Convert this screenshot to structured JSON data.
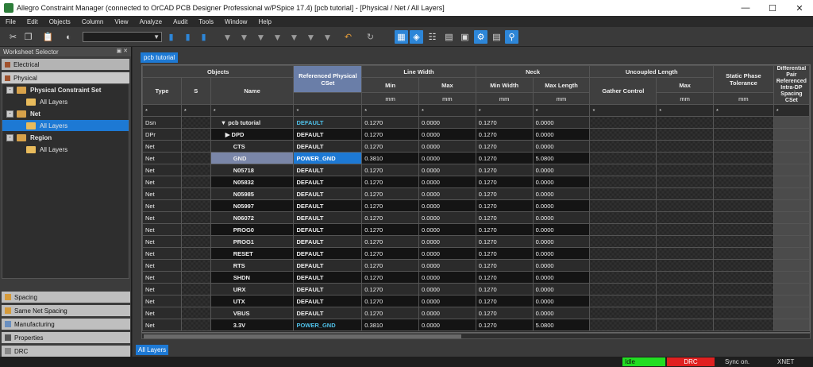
{
  "window": {
    "title": "Allegro Constraint Manager (connected to OrCAD PCB Designer Professional w/PSpice 17.4) [pcb tutorial] - [Physical / Net / All Layers]"
  },
  "menu": [
    "File",
    "Edit",
    "Objects",
    "Column",
    "View",
    "Analyze",
    "Audit",
    "Tools",
    "Window",
    "Help"
  ],
  "sidebar": {
    "title": "Worksheet Selector",
    "top_sets": [
      "Electrical",
      "Physical"
    ],
    "tree": [
      {
        "label": "Physical Constraint Set",
        "level": 0,
        "toggle": "-"
      },
      {
        "label": "All Layers",
        "level": 1
      },
      {
        "label": "Net",
        "level": 0,
        "toggle": "-"
      },
      {
        "label": "All Layers",
        "level": 1,
        "selected": true
      },
      {
        "label": "Region",
        "level": 0,
        "toggle": "-"
      },
      {
        "label": "All Layers",
        "level": 1
      }
    ],
    "bottom_sets": [
      "Spacing",
      "Same Net Spacing",
      "Manufacturing",
      "Properties",
      "DRC"
    ]
  },
  "tabs": {
    "top": "pcb tutorial",
    "bottom": "All Layers"
  },
  "grid": {
    "group_headers": {
      "objects": "Objects",
      "ref": "Referenced Physical CSet",
      "line_width": "Line Width",
      "neck": "Neck",
      "uncoupled": "Uncoupled Length",
      "phase": "Static Phase Tolerance",
      "diff": "Differential Pair Referenced Intra-DP Spacing CSet"
    },
    "sub_headers": {
      "type": "Type",
      "s": "S",
      "name": "Name",
      "min": "Min",
      "max": "Max",
      "min_width": "Min Width",
      "max_length": "Max Length",
      "gather": "Gather Control",
      "umax": "Max"
    },
    "unit": "mm",
    "filter": "*",
    "rows": [
      {
        "type": "Dsn",
        "name": "▼ pcb tutorial",
        "cset": "DEFAULT",
        "lmin": "0.1270",
        "lmax": "0.0000",
        "nmin": "0.1270",
        "nmax": "0.0000",
        "kind": "dsn"
      },
      {
        "type": "DPr",
        "name": "▶ DPD",
        "cset": "DEFAULT",
        "lmin": "0.1270",
        "lmax": "0.0000",
        "nmin": "0.1270",
        "nmax": "0.0000",
        "kind": "dpr"
      },
      {
        "type": "Net",
        "name": "CTS",
        "cset": "DEFAULT",
        "lmin": "0.1270",
        "lmax": "0.0000",
        "nmin": "0.1270",
        "nmax": "0.0000"
      },
      {
        "type": "Net",
        "name": "GND",
        "cset": "POWER_GND",
        "lmin": "0.3810",
        "lmax": "0.0000",
        "nmin": "0.1270",
        "nmax": "5.0800",
        "kind": "sel"
      },
      {
        "type": "Net",
        "name": "N05718",
        "cset": "DEFAULT",
        "lmin": "0.1270",
        "lmax": "0.0000",
        "nmin": "0.1270",
        "nmax": "0.0000"
      },
      {
        "type": "Net",
        "name": "N05832",
        "cset": "DEFAULT",
        "lmin": "0.1270",
        "lmax": "0.0000",
        "nmin": "0.1270",
        "nmax": "0.0000"
      },
      {
        "type": "Net",
        "name": "N05985",
        "cset": "DEFAULT",
        "lmin": "0.1270",
        "lmax": "0.0000",
        "nmin": "0.1270",
        "nmax": "0.0000"
      },
      {
        "type": "Net",
        "name": "N05997",
        "cset": "DEFAULT",
        "lmin": "0.1270",
        "lmax": "0.0000",
        "nmin": "0.1270",
        "nmax": "0.0000"
      },
      {
        "type": "Net",
        "name": "N06072",
        "cset": "DEFAULT",
        "lmin": "0.1270",
        "lmax": "0.0000",
        "nmin": "0.1270",
        "nmax": "0.0000"
      },
      {
        "type": "Net",
        "name": "PROG0",
        "cset": "DEFAULT",
        "lmin": "0.1270",
        "lmax": "0.0000",
        "nmin": "0.1270",
        "nmax": "0.0000"
      },
      {
        "type": "Net",
        "name": "PROG1",
        "cset": "DEFAULT",
        "lmin": "0.1270",
        "lmax": "0.0000",
        "nmin": "0.1270",
        "nmax": "0.0000"
      },
      {
        "type": "Net",
        "name": "RESET",
        "cset": "DEFAULT",
        "lmin": "0.1270",
        "lmax": "0.0000",
        "nmin": "0.1270",
        "nmax": "0.0000"
      },
      {
        "type": "Net",
        "name": "RTS",
        "cset": "DEFAULT",
        "lmin": "0.1270",
        "lmax": "0.0000",
        "nmin": "0.1270",
        "nmax": "0.0000"
      },
      {
        "type": "Net",
        "name": "SHDN",
        "cset": "DEFAULT",
        "lmin": "0.1270",
        "lmax": "0.0000",
        "nmin": "0.1270",
        "nmax": "0.0000"
      },
      {
        "type": "Net",
        "name": "URX",
        "cset": "DEFAULT",
        "lmin": "0.1270",
        "lmax": "0.0000",
        "nmin": "0.1270",
        "nmax": "0.0000"
      },
      {
        "type": "Net",
        "name": "UTX",
        "cset": "DEFAULT",
        "lmin": "0.1270",
        "lmax": "0.0000",
        "nmin": "0.1270",
        "nmax": "0.0000"
      },
      {
        "type": "Net",
        "name": "VBUS",
        "cset": "DEFAULT",
        "lmin": "0.1270",
        "lmax": "0.0000",
        "nmin": "0.1270",
        "nmax": "0.0000"
      },
      {
        "type": "Net",
        "name": "3.3V",
        "cset": "POWER_GND",
        "lmin": "0.3810",
        "lmax": "0.0000",
        "nmin": "0.1270",
        "nmax": "5.0800"
      }
    ]
  },
  "status": {
    "idle": "Idle",
    "drc": "DRC",
    "sync": "Sync on.",
    "mode": "XNET"
  },
  "colors": {
    "accent": "#1d79d4",
    "cset_power": "#4fc0e8",
    "idle": "#22dd22",
    "drc": "#e02020"
  }
}
